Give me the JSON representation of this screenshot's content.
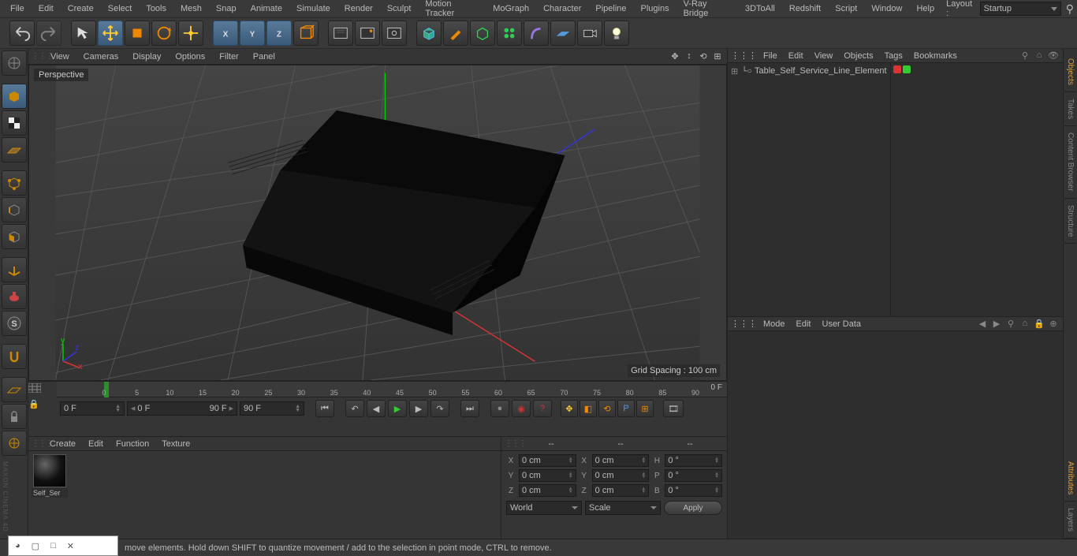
{
  "menubar": [
    "File",
    "Edit",
    "Create",
    "Select",
    "Tools",
    "Mesh",
    "Snap",
    "Animate",
    "Simulate",
    "Render",
    "Sculpt",
    "Motion Tracker",
    "MoGraph",
    "Character",
    "Pipeline",
    "Plugins",
    "V-Ray Bridge",
    "3DToAll",
    "Redshift",
    "Script",
    "Window",
    "Help"
  ],
  "layout": {
    "label": "Layout :",
    "value": "Startup"
  },
  "viewport": {
    "menus": [
      "View",
      "Cameras",
      "Display",
      "Options",
      "Filter",
      "Panel"
    ],
    "label": "Perspective",
    "grid_info": "Grid Spacing : 100 cm"
  },
  "timeline": {
    "ticks": [
      "0",
      "5",
      "10",
      "15",
      "20",
      "25",
      "30",
      "35",
      "40",
      "45",
      "50",
      "55",
      "60",
      "65",
      "70",
      "75",
      "80",
      "85",
      "90"
    ],
    "end_label": "0 F",
    "f1": "0 F",
    "f2": "0 F",
    "f3": "90 F",
    "f4": "90 F"
  },
  "materials": {
    "menus": [
      "Create",
      "Edit",
      "Function",
      "Texture"
    ],
    "item_name": "Self_Ser"
  },
  "coords": {
    "head": [
      "--",
      "--",
      "--"
    ],
    "rows": [
      {
        "a": "X",
        "v1": "0 cm",
        "b": "X",
        "v2": "0 cm",
        "c": "H",
        "v3": "0 °"
      },
      {
        "a": "Y",
        "v1": "0 cm",
        "b": "Y",
        "v2": "0 cm",
        "c": "P",
        "v3": "0 °"
      },
      {
        "a": "Z",
        "v1": "0 cm",
        "b": "Z",
        "v2": "0 cm",
        "c": "B",
        "v3": "0 °"
      }
    ],
    "dd1": "World",
    "dd2": "Scale",
    "apply": "Apply"
  },
  "objects": {
    "menus": [
      "File",
      "Edit",
      "View",
      "Objects",
      "Tags",
      "Bookmarks"
    ],
    "root": "Table_Self_Service_Line_Element"
  },
  "attributes": {
    "menus": [
      "Mode",
      "Edit",
      "User Data"
    ]
  },
  "side_tabs_top": [
    "Objects",
    "Takes",
    "Content Browser",
    "Structure"
  ],
  "side_tabs_bottom": [
    "Attributes",
    "Layers"
  ],
  "status": "move elements. Hold down SHIFT to quantize movement / add to the selection in point mode, CTRL to remove."
}
